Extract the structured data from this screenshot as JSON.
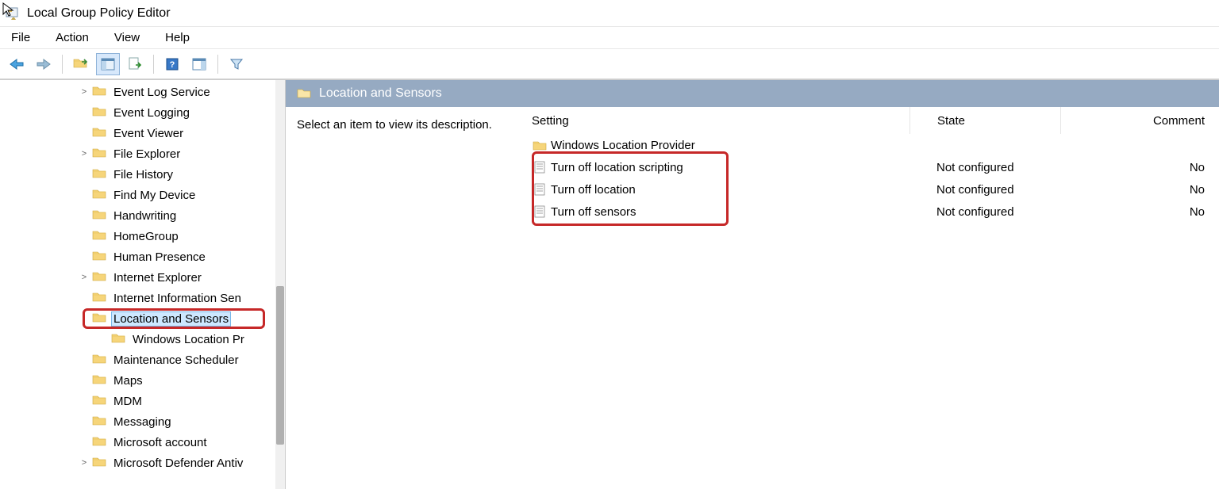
{
  "window": {
    "title": "Local Group Policy Editor"
  },
  "menu": {
    "file": "File",
    "action": "Action",
    "view": "View",
    "help": "Help"
  },
  "toolbar_icons": {
    "back": "Back",
    "forward": "Forward",
    "up": "Up one level",
    "show_hide": "Show/Hide Console Tree",
    "export": "Export List",
    "help": "Help",
    "toggle": "Show/Hide Action Pane",
    "filter": "Filter"
  },
  "tree": {
    "items": [
      {
        "label": "Event Log Service",
        "expander": ">",
        "indent": 0
      },
      {
        "label": "Event Logging",
        "expander": "",
        "indent": 0
      },
      {
        "label": "Event Viewer",
        "expander": "",
        "indent": 0
      },
      {
        "label": "File Explorer",
        "expander": ">",
        "indent": 0
      },
      {
        "label": "File History",
        "expander": "",
        "indent": 0
      },
      {
        "label": "Find My Device",
        "expander": "",
        "indent": 0
      },
      {
        "label": "Handwriting",
        "expander": "",
        "indent": 0
      },
      {
        "label": "HomeGroup",
        "expander": "",
        "indent": 0
      },
      {
        "label": "Human Presence",
        "expander": "",
        "indent": 0
      },
      {
        "label": "Internet Explorer",
        "expander": ">",
        "indent": 0
      },
      {
        "label": "Internet Information Sen",
        "expander": "",
        "indent": 0
      },
      {
        "label": "Location and Sensors",
        "expander": "",
        "indent": 0,
        "selected": true,
        "highlight": true
      },
      {
        "label": "Windows Location Pr",
        "expander": "",
        "indent": 1
      },
      {
        "label": "Maintenance Scheduler",
        "expander": "",
        "indent": 0
      },
      {
        "label": "Maps",
        "expander": "",
        "indent": 0
      },
      {
        "label": "MDM",
        "expander": "",
        "indent": 0
      },
      {
        "label": "Messaging",
        "expander": "",
        "indent": 0
      },
      {
        "label": "Microsoft account",
        "expander": "",
        "indent": 0
      },
      {
        "label": "Microsoft Defender Antiv",
        "expander": ">",
        "indent": 0
      }
    ]
  },
  "content": {
    "header_title": "Location and Sensors",
    "description_prompt": "Select an item to view its description.",
    "columns": {
      "setting": "Setting",
      "state": "State",
      "comment": "Comment"
    },
    "rows": [
      {
        "type": "folder",
        "setting": "Windows Location Provider",
        "state": "",
        "comment": ""
      },
      {
        "type": "policy",
        "setting": "Turn off location scripting",
        "state": "Not configured",
        "comment": "No"
      },
      {
        "type": "policy",
        "setting": "Turn off location",
        "state": "Not configured",
        "comment": "No"
      },
      {
        "type": "policy",
        "setting": "Turn off sensors",
        "state": "Not configured",
        "comment": "No"
      }
    ]
  }
}
